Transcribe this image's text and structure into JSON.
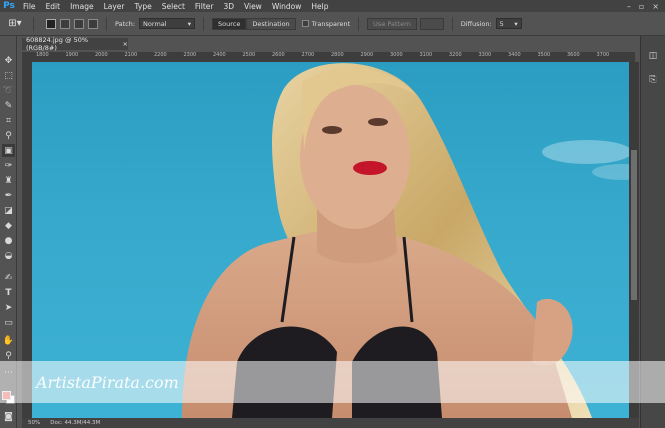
{
  "app": {
    "logo": "Ps"
  },
  "menu": [
    "File",
    "Edit",
    "Image",
    "Layer",
    "Type",
    "Select",
    "Filter",
    "3D",
    "View",
    "Window",
    "Help"
  ],
  "window_controls": [
    "–",
    "▫",
    "×"
  ],
  "options_bar": {
    "patch_label": "Patch:",
    "patch_value": "Normal",
    "source_label": "Source",
    "destination_label": "Destination",
    "transparent_label": "Transparent",
    "use_pattern_label": "Use Pattern",
    "diffusion_label": "Diffusion:",
    "diffusion_value": "5"
  },
  "document": {
    "tab_title": "608824.jpg @ 50% (RGB/8#)",
    "close": "×",
    "ruler_ticks": [
      "1800",
      "1900",
      "2000",
      "2100",
      "2200",
      "2300",
      "2400",
      "2500",
      "2600",
      "2700",
      "2800",
      "2900",
      "3000",
      "3100",
      "3200",
      "3300",
      "3400",
      "3500",
      "3600",
      "3700"
    ]
  },
  "status": {
    "zoom": "50%",
    "doc_info": "Doc: 44.3M/44.3M"
  },
  "watermark": {
    "text": "ArtistaPirata.com"
  },
  "colors": {
    "foreground": "#e96c6c",
    "background": "#ffffff",
    "sky": "#2fa3c8"
  },
  "icons": {
    "tools": [
      "move-icon",
      "marquee-icon",
      "lasso-icon",
      "quick-select-icon",
      "crop-icon",
      "eyedropper-icon",
      "patch-icon",
      "brush-icon",
      "stamp-icon",
      "history-brush-icon",
      "eraser-icon",
      "gradient-icon",
      "blur-icon",
      "dodge-icon",
      "pen-icon",
      "type-icon",
      "path-select-icon",
      "rectangle-icon",
      "hand-icon",
      "zoom-icon"
    ]
  }
}
